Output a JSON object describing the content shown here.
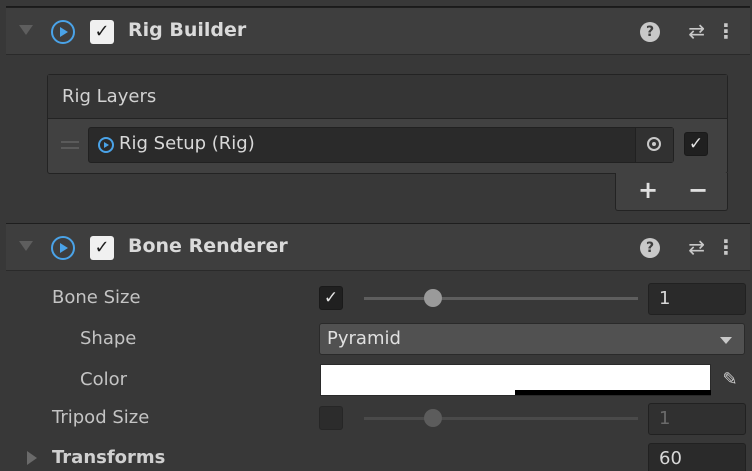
{
  "rig_builder": {
    "title": "Rig Builder",
    "enabled_mark": "✓",
    "help_glyph": "?",
    "preset_glyph": "⇄",
    "menu_glyph": "⋮",
    "rig_layers_header": "Rig Layers",
    "layers": [
      {
        "label": "Rig Setup (Rig)",
        "active_mark": "✓"
      }
    ],
    "add_label": "+",
    "remove_label": "−"
  },
  "bone_renderer": {
    "title": "Bone Renderer",
    "enabled_mark": "✓",
    "help_glyph": "?",
    "preset_glyph": "⇄",
    "menu_glyph": "⋮",
    "bone_size": {
      "label": "Bone Size",
      "checked_mark": "✓",
      "value": "1",
      "slider_fraction": 0.22
    },
    "shape": {
      "label": "Shape",
      "value": "Pyramid"
    },
    "color": {
      "label": "Color",
      "value": "#ffffff",
      "eyedropper_glyph": "✎"
    },
    "tripod_size": {
      "label": "Tripod Size",
      "checked_mark": "",
      "value": "1",
      "slider_fraction": 0.22
    },
    "transforms": {
      "label": "Transforms",
      "count": "60"
    }
  },
  "colors": {
    "background": "#383838",
    "header": "#3e3e3e",
    "script_icon": "#4aa3e8",
    "field": "#2a2a2a"
  }
}
